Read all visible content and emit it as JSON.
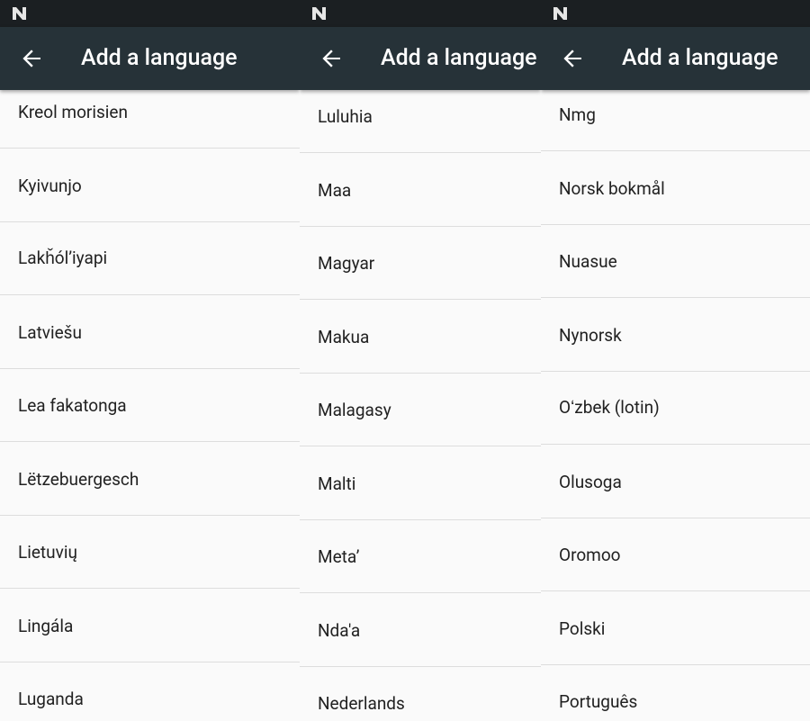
{
  "screen_title": "Add a language",
  "panels": [
    {
      "items": [
        "Kreol morisien",
        "Kyivunjo",
        "Lakȟól’iyapi",
        "Latviešu",
        "Lea fakatonga",
        "Lëtzebuergesch",
        "Lietuvių",
        "Lingála",
        "Luganda"
      ]
    },
    {
      "items": [
        "Luluhia",
        "Maa",
        "Magyar",
        "Makua",
        "Malagasy",
        "Malti",
        "Meta’",
        "Nda'a",
        "Nederlands"
      ]
    },
    {
      "items": [
        "Nmg",
        "Norsk bokmål",
        "Nuasue",
        "Nynorsk",
        "Oʻzbek (lotin)",
        "Olusoga",
        "Oromoo",
        "Polski",
        "Português"
      ]
    }
  ],
  "colors": {
    "statusbar": "#1b1f22",
    "appbar": "#263238",
    "list_bg": "#fafafa",
    "text": "#212121",
    "divider": "#dddddd"
  },
  "icons": {
    "status": "android-n-icon",
    "back": "back-arrow-icon"
  }
}
